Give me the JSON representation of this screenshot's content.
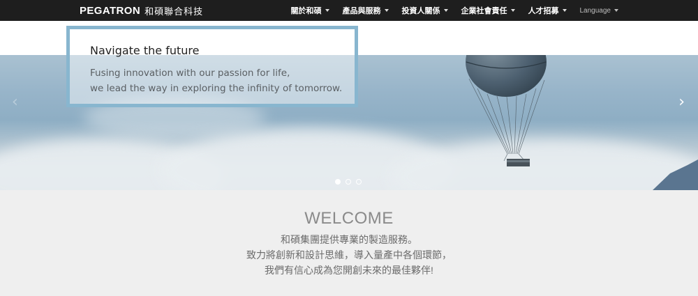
{
  "brand": {
    "logo_latin": "PEGATRON",
    "logo_cjk": "和碩聯合科技"
  },
  "nav": {
    "items": [
      {
        "label": "關於和碩"
      },
      {
        "label": "產品與服務"
      },
      {
        "label": "投資人關係"
      },
      {
        "label": "企業社會責任"
      },
      {
        "label": "人才招募"
      }
    ],
    "language_label": "Language"
  },
  "hero": {
    "title": "Navigate the future",
    "line1": "Fusing innovation with our passion for life,",
    "line2": "we lead the way in exploring the infinity of tomorrow.",
    "prev_arrow": "‹",
    "next_arrow": "›",
    "slide_count": 3,
    "active_slide": 1
  },
  "welcome": {
    "title": "WELCOME",
    "line1": "和碩集團提供專業的製造服務。",
    "line2": "致力將創新和設計思維，導入量產中各個環節，",
    "line3": "我們有信心成為您開創未來的最佳夥伴!"
  },
  "colors": {
    "navbar_bg": "#1e1e1e",
    "caption_border": "#88b6cf",
    "page_bg": "#efefef"
  }
}
